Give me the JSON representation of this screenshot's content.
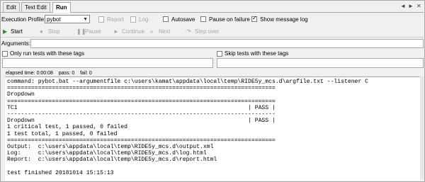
{
  "tabs": [
    {
      "label": "Edit"
    },
    {
      "label": "Text Edit"
    },
    {
      "label": "Run"
    }
  ],
  "tab_nav": {
    "left": "◄",
    "right": "►",
    "close": "✕"
  },
  "toolbar": {
    "execution_profile_label": "Execution Profile:",
    "execution_profile_value": "pybot",
    "report_label": "Report",
    "log_label": "Log",
    "autosave_label": "Autosave",
    "pause_on_failure_label": "Pause on failure",
    "show_message_log_label": "Show message log",
    "show_message_log_checked": true,
    "start_label": "Start",
    "stop_label": "Stop",
    "pause_label": "Pause",
    "continue_label": "Continue",
    "next_label": "Next",
    "step_over_label": "Step over"
  },
  "arguments": {
    "label": "Arguments:",
    "value": ""
  },
  "tags": {
    "only_run_label": "Only run tests with these tags",
    "skip_label": "Skip tests with these tags"
  },
  "status": {
    "elapsed": "elapsed time: 0:00:08",
    "pass": "pass: 0",
    "fail": "fail: 0"
  },
  "output_lines": [
    "command: pybot.bat --argumentfile c:\\users\\kamat\\appdata\\local\\temp\\RIDE5y_mcs.d\\argfile.txt --listener C",
    "==============================================================================",
    "Dropdown",
    "==============================================================================",
    "TC1                                                                   | PASS |",
    "------------------------------------------------------------------------------",
    "Dropdown                                                              | PASS |",
    "1 critical test, 1 passed, 0 failed",
    "1 test total, 1 passed, 0 failed",
    "==============================================================================",
    "Output:  c:\\users\\appdata\\local\\temp\\RIDE5y_mcs.d\\output.xml",
    "Log:     c:\\users\\appdata\\local\\temp\\RIDE5y_mcs.d\\log.html",
    "Report:  c:\\users\\appdata\\local\\temp\\RIDE5y_mcs.d\\report.html",
    "",
    "test finished 20181014 15:15:13"
  ]
}
